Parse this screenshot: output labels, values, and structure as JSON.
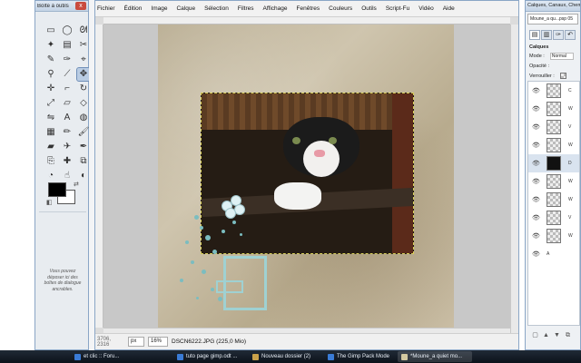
{
  "toolbox": {
    "title": "Boîte à outils",
    "close_label": "x",
    "drop_hint": "Vous pouvez déposer ici des boîtes de dialogue ancrables.",
    "tools": [
      {
        "name": "rect-select-icon",
        "glyph": "▭"
      },
      {
        "name": "ellipse-select-icon",
        "glyph": "◯"
      },
      {
        "name": "lasso-icon",
        "glyph": "ᘛ"
      },
      {
        "name": "fuzzy-select-icon",
        "glyph": "✦"
      },
      {
        "name": "color-select-icon",
        "glyph": "▤"
      },
      {
        "name": "scissors-icon",
        "glyph": "✂"
      },
      {
        "name": "foreground-select-icon",
        "glyph": "✎"
      },
      {
        "name": "paths-icon",
        "glyph": "✑"
      },
      {
        "name": "color-picker-icon",
        "glyph": "⌖"
      },
      {
        "name": "zoom-icon",
        "glyph": "⚲"
      },
      {
        "name": "measure-icon",
        "glyph": "⟋"
      },
      {
        "name": "move-icon",
        "glyph": "✥"
      },
      {
        "name": "align-icon",
        "glyph": "✛"
      },
      {
        "name": "crop-icon",
        "glyph": "⌐"
      },
      {
        "name": "rotate-icon",
        "glyph": "↻"
      },
      {
        "name": "scale-icon",
        "glyph": "⤢"
      },
      {
        "name": "shear-icon",
        "glyph": "▱"
      },
      {
        "name": "perspective-icon",
        "glyph": "◇"
      },
      {
        "name": "flip-icon",
        "glyph": "⇋"
      },
      {
        "name": "text-icon",
        "glyph": "A"
      },
      {
        "name": "bucket-fill-icon",
        "glyph": "◍"
      },
      {
        "name": "blend-icon",
        "glyph": "▦"
      },
      {
        "name": "pencil-icon",
        "glyph": "✏"
      },
      {
        "name": "paintbrush-icon",
        "glyph": "🖌"
      },
      {
        "name": "eraser-icon",
        "glyph": "▰"
      },
      {
        "name": "airbrush-icon",
        "glyph": "✈"
      },
      {
        "name": "ink-icon",
        "glyph": "✒"
      },
      {
        "name": "clone-icon",
        "glyph": "⎘"
      },
      {
        "name": "heal-icon",
        "glyph": "✚"
      },
      {
        "name": "perspective-clone-icon",
        "glyph": "⧉"
      },
      {
        "name": "blur-icon",
        "glyph": "◔"
      },
      {
        "name": "smudge-icon",
        "glyph": "☝"
      },
      {
        "name": "dodge-burn-icon",
        "glyph": "◐"
      }
    ],
    "active_tool": "move-icon",
    "fg_color": "#000000",
    "bg_color": "#ffffff"
  },
  "image_window": {
    "menus": [
      "Fichier",
      "Édition",
      "Image",
      "Calque",
      "Sélection",
      "Filtres",
      "Affichage",
      "Fenêtres",
      "Couleurs",
      "Outils",
      "Script-Fu",
      "Vidéo",
      "Aide"
    ],
    "status": {
      "coords": "3706, 2316",
      "unit": "px",
      "zoom": "16%",
      "info": "DSCN6222.JPG (225,0 Mio)"
    }
  },
  "layers": {
    "title": "Calques, Canaux, Chemins",
    "image_select": "Moune_a qu...psp 05",
    "section_label": "Calques",
    "mode_label": "Mode :",
    "mode_value": "Normal",
    "opacity_label": "Opacité :",
    "lock_label": "Verrouiller :",
    "items": [
      {
        "thumb": "checker",
        "name": "C"
      },
      {
        "thumb": "checker",
        "name": "W"
      },
      {
        "thumb": "checker",
        "name": "V"
      },
      {
        "thumb": "checker",
        "name": "W"
      },
      {
        "thumb": "dark",
        "name": "D"
      },
      {
        "thumb": "checker",
        "name": "W"
      },
      {
        "thumb": "checker",
        "name": "W"
      },
      {
        "thumb": "checker",
        "name": "V"
      },
      {
        "thumb": "checker",
        "name": "W"
      },
      {
        "thumb": "paper",
        "name": "A"
      }
    ]
  },
  "taskbar": {
    "items": [
      {
        "label": "et clic :: Foru...",
        "icon": "blue",
        "active": false
      },
      {
        "label": "tuto page gimp.odt ...",
        "icon": "blue",
        "active": false
      },
      {
        "label": "Nouveau dossier (2)",
        "icon": "folder",
        "active": false
      },
      {
        "label": "The Gimp Pack Mode",
        "icon": "blue",
        "active": false
      },
      {
        "label": "*Moune_a quiet mo...",
        "icon": "gimp",
        "active": true
      }
    ]
  }
}
